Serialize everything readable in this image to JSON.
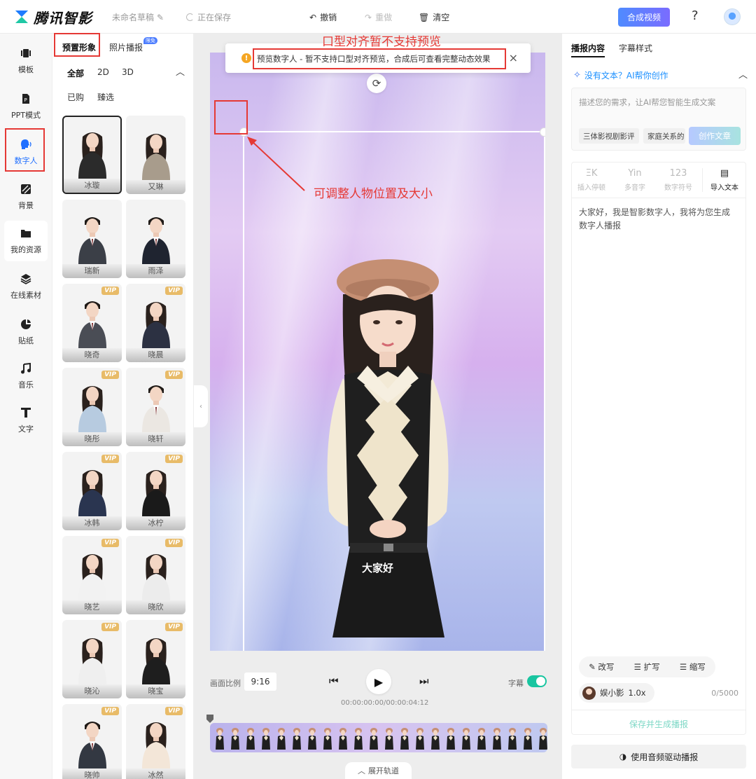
{
  "header": {
    "logo_text": "腾讯智影",
    "draft_name": "未命名草稿",
    "save_status": "正在保存",
    "undo": "撤销",
    "redo": "重做",
    "clear": "清空",
    "compose": "合成视频",
    "help": "?"
  },
  "rail": {
    "items": [
      {
        "label": "模板",
        "icon": "template-icon"
      },
      {
        "label": "PPT模式",
        "icon": "ppt-icon"
      },
      {
        "label": "数字人",
        "icon": "digital-human-icon"
      },
      {
        "label": "背景",
        "icon": "background-icon"
      },
      {
        "label": "我的资源",
        "icon": "folder-icon"
      },
      {
        "label": "在线素材",
        "icon": "layers-icon"
      },
      {
        "label": "贴纸",
        "icon": "sticker-icon"
      },
      {
        "label": "音乐",
        "icon": "music-icon"
      },
      {
        "label": "文字",
        "icon": "text-icon"
      }
    ]
  },
  "library": {
    "tabs": [
      "预置形象",
      "照片播报"
    ],
    "new_badge": "限免",
    "filters": [
      "全部",
      "2D",
      "3D"
    ],
    "sub_filters": [
      "已购",
      "臻选"
    ],
    "vip_label": "VIP",
    "avatars": [
      {
        "name": "冰璇",
        "vip": false,
        "gender": "f",
        "outfit": "#2b2b2b"
      },
      {
        "name": "又琳",
        "vip": false,
        "gender": "f",
        "outfit": "#a89c8c"
      },
      {
        "name": "瑞新",
        "vip": false,
        "gender": "m",
        "outfit": "#3b3f47"
      },
      {
        "name": "雨泽",
        "vip": false,
        "gender": "m",
        "outfit": "#1f2430"
      },
      {
        "name": "晓奇",
        "vip": true,
        "gender": "m",
        "outfit": "#4a4d55"
      },
      {
        "name": "晓晨",
        "vip": true,
        "gender": "f",
        "outfit": "#2c3142"
      },
      {
        "name": "晓彤",
        "vip": true,
        "gender": "f",
        "outfit": "#b7cbe0"
      },
      {
        "name": "晓轩",
        "vip": true,
        "gender": "m",
        "outfit": "#ebe7e2"
      },
      {
        "name": "冰韩",
        "vip": true,
        "gender": "f",
        "outfit": "#2a3550"
      },
      {
        "name": "冰柠",
        "vip": true,
        "gender": "f",
        "outfit": "#1a1a1a"
      },
      {
        "name": "晓艺",
        "vip": true,
        "gender": "f",
        "outfit": "#f2f2f2"
      },
      {
        "name": "晓欣",
        "vip": true,
        "gender": "f",
        "outfit": "#ececec"
      },
      {
        "name": "晓沁",
        "vip": true,
        "gender": "f",
        "outfit": "#efefef"
      },
      {
        "name": "晓宝",
        "vip": true,
        "gender": "f",
        "outfit": "#1e1e1e"
      },
      {
        "name": "晓帅",
        "vip": true,
        "gender": "m",
        "outfit": "#333842"
      },
      {
        "name": "冰然",
        "vip": true,
        "gender": "f",
        "outfit": "#f3e6d8"
      }
    ]
  },
  "stage": {
    "notice": "预览数字人 - 暂不支持口型对齐预览，合成后可查看完整动态效果",
    "annotation_title": "口型对齐暂不支持预览",
    "annotation_resize": "可调整人物位置及大小",
    "subtitle": "大家好",
    "ratio_label": "画面比例",
    "ratio_value": "9:16",
    "timecode": "00:00:00:00/00:00:04:12",
    "subtitle_toggle_label": "字幕",
    "subtitle_toggle_on": true,
    "expand_track": "展开轨道",
    "timeline_frames": 22
  },
  "right": {
    "tabs": [
      "播报内容",
      "字幕样式"
    ],
    "ai_prompt": "没有文本？AI帮你创作",
    "ai_placeholder": "描述您的需求，让AI帮您智能生成文案",
    "ai_chips": [
      "三体影视剧影评",
      "家庭关系的"
    ],
    "ai_create": "创作文章",
    "tools": [
      {
        "icon": "ΞK",
        "label": "插入停顿"
      },
      {
        "icon": "Yin",
        "label": "多音字"
      },
      {
        "icon": "123",
        "label": "数字符号"
      },
      {
        "icon": "▤",
        "label": "导入文本"
      }
    ],
    "script": "大家好，我是智影数字人，我将为您生成数字人播报",
    "edit_actions": [
      "改写",
      "扩写",
      "缩写"
    ],
    "voice_name": "娱小影",
    "voice_speed": "1.0x",
    "char_count": "0/5000",
    "save_generate": "保存并生成播报",
    "audio_drive": "使用音频驱动播报"
  }
}
